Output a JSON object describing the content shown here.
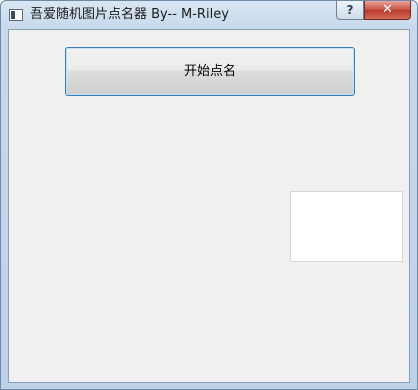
{
  "window": {
    "title": "吾爱随机图片点名器  By-- M-Riley"
  },
  "titlebar_buttons": {
    "help": "?",
    "close": "✕"
  },
  "main": {
    "start_button_label": "开始点名"
  }
}
